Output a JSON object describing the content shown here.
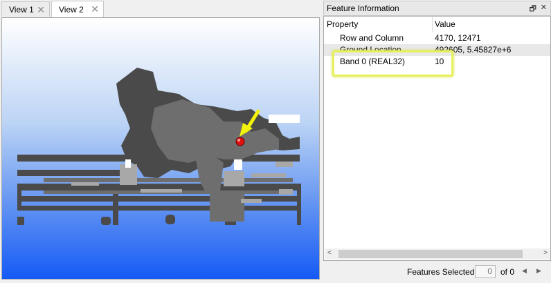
{
  "tabs": [
    {
      "label": "View 1",
      "close": "✕"
    },
    {
      "label": "View 2",
      "close": "✕"
    }
  ],
  "feature_panel": {
    "title": "Feature Information",
    "restore_icon": "🗗",
    "close_icon": "✕",
    "headers": {
      "property": "Property",
      "value": "Value"
    },
    "rows": [
      {
        "property": "Row and Column",
        "value": "4170, 12471"
      },
      {
        "property": "Ground Location",
        "value": "492605, 5.45827e+6"
      },
      {
        "property": "Band 0 (REAL32)",
        "value": "10"
      }
    ]
  },
  "status": {
    "features_selected_label": "Features Selected:",
    "selected_count": "0",
    "of_total": "of 0",
    "prev_icon": "◀",
    "next_icon": "▶"
  },
  "scroll": {
    "left_icon": "<",
    "right_icon": ">"
  },
  "colors": {
    "marker": "#e01010",
    "arrow": "#f2f20a",
    "highlight": "#e6f05a"
  }
}
